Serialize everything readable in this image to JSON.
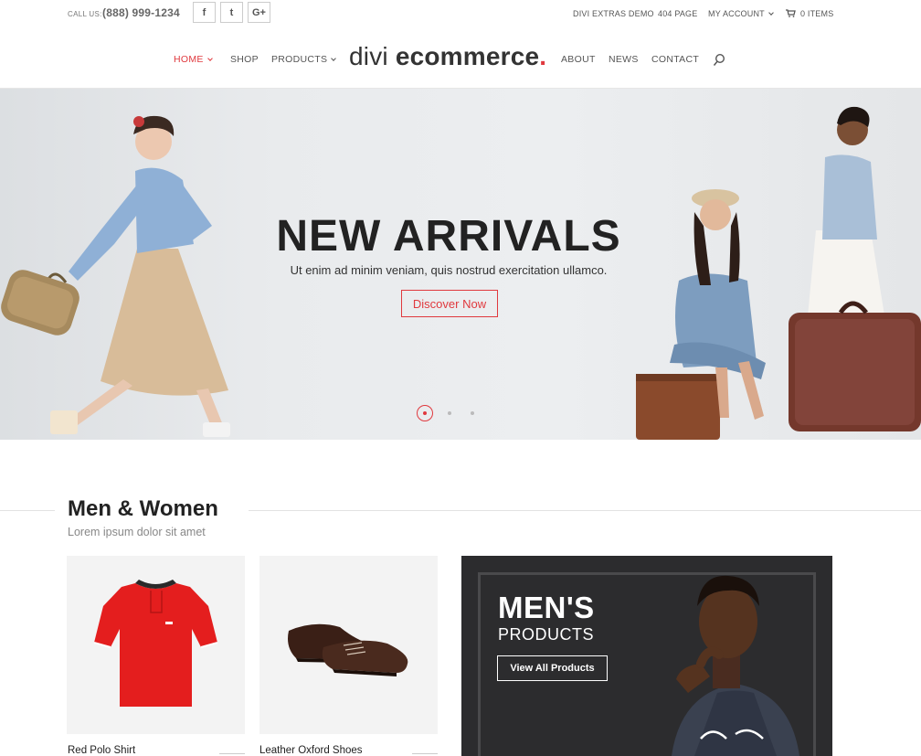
{
  "topbar": {
    "call_label": "CALL US:",
    "phone": "(888) 999-1234",
    "social": [
      {
        "icon": "facebook-icon",
        "glyph": "f"
      },
      {
        "icon": "twitter-icon",
        "glyph": "t"
      },
      {
        "icon": "google-plus-icon",
        "glyph": "G+"
      }
    ],
    "links": {
      "extras": "DIVI EXTRAS DEMO",
      "page404": "404 PAGE",
      "account": "MY ACCOUNT",
      "cart": "0 ITEMS"
    }
  },
  "nav": {
    "home": "HOME",
    "shop": "SHOP",
    "products": "PRODUCTS",
    "about": "ABOUT",
    "news": "NEWS",
    "contact": "CONTACT"
  },
  "logo": {
    "light": "divi",
    "bold": "ecommerce",
    "dot": "."
  },
  "hero": {
    "title": "NEW ARRIVALS",
    "subtitle": "Ut enim ad minim veniam, quis nostrud exercitation ullamco.",
    "button": "Discover Now",
    "slides_count": 3,
    "active_slide": 1
  },
  "section": {
    "title": "Men & Women",
    "subtitle": "Lorem ipsum dolor sit amet"
  },
  "products": [
    {
      "name": "Red Polo Shirt"
    },
    {
      "name": "Leather Oxford Shoes"
    }
  ],
  "promo": {
    "title": "MEN'S",
    "subtitle": "PRODUCTS",
    "button": "View All Products"
  },
  "colors": {
    "accent": "#e0393e",
    "text_dark": "#222222",
    "promo_bg": "#2c2c2e"
  }
}
